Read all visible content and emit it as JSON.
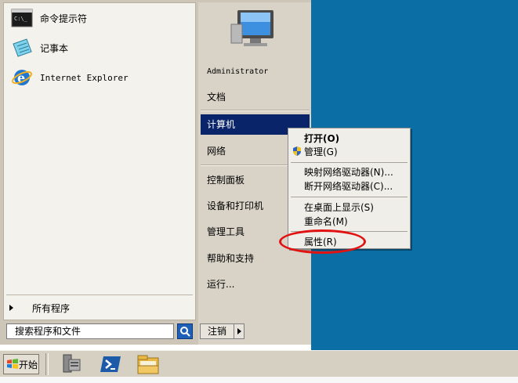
{
  "start_menu": {
    "pinned": [
      {
        "label": "命令提示符",
        "icon": "cmd-icon"
      },
      {
        "label": "记事本",
        "icon": "notepad-icon"
      },
      {
        "label": "Internet Explorer",
        "icon": "ie-icon"
      }
    ],
    "all_programs": "所有程序",
    "search_placeholder": "搜索程序和文件",
    "right_items": [
      {
        "label": "Administrator"
      },
      {
        "label": "文档"
      },
      {
        "label": "计算机",
        "selected": true
      },
      {
        "label": "网络"
      },
      {
        "label": "控制面板"
      },
      {
        "label": "设备和打印机"
      },
      {
        "label": "管理工具"
      },
      {
        "label": "帮助和支持"
      },
      {
        "label": "运行..."
      }
    ],
    "logoff_label": "注销"
  },
  "context_menu": {
    "items": [
      {
        "label": "打开(O)",
        "bold": true
      },
      {
        "label": "管理(G)",
        "icon": "shield-icon"
      },
      {
        "label": "映射网络驱动器(N)..."
      },
      {
        "label": "断开网络驱动器(C)..."
      },
      {
        "label": "在桌面上显示(S)"
      },
      {
        "label": "重命名(M)"
      },
      {
        "label": "属性(R)",
        "highlighted": true
      }
    ]
  },
  "taskbar": {
    "start_label": "开始",
    "icons": [
      "server-manager-icon",
      "powershell-icon",
      "explorer-folder-icon"
    ]
  },
  "colors": {
    "desktop": "#0b6fa6",
    "selection": "#0a246a",
    "highlight_ring": "#e11212"
  }
}
